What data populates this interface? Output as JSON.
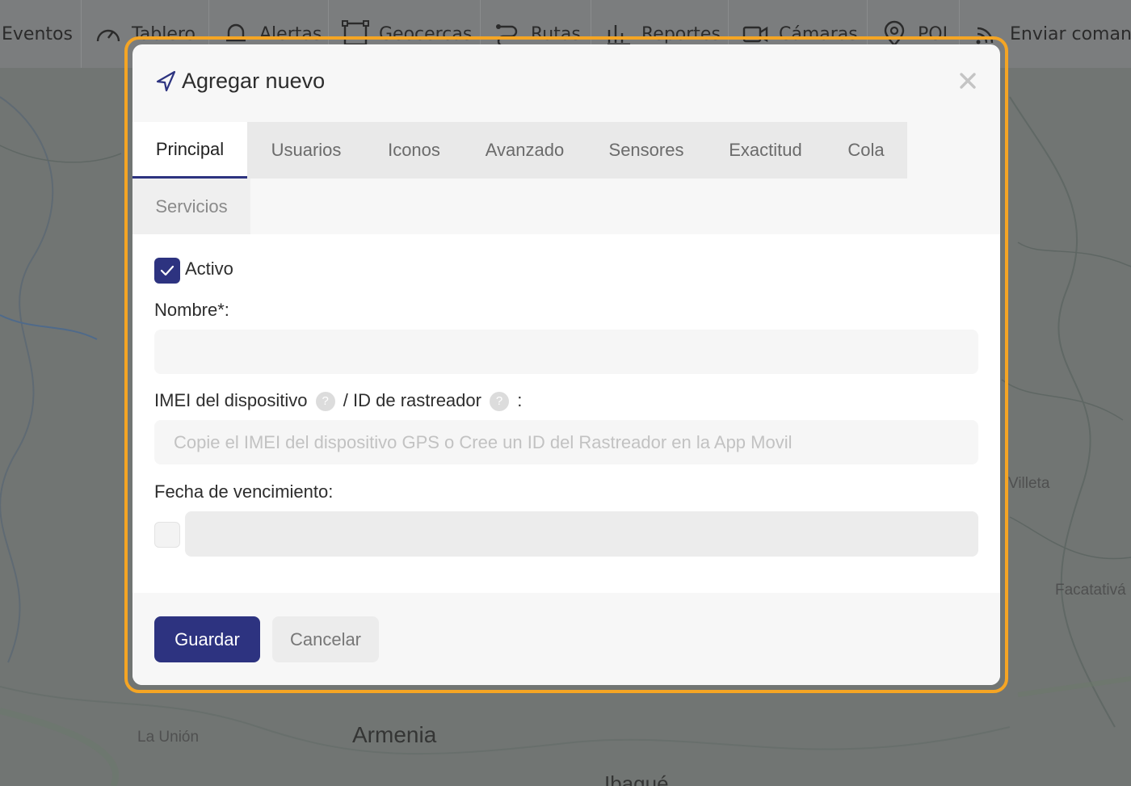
{
  "nav": {
    "items": [
      {
        "label": "Eventos",
        "icon": "none"
      },
      {
        "label": "Tablero",
        "icon": "gauge-icon"
      },
      {
        "label": "Alertas",
        "icon": "bell-icon"
      },
      {
        "label": "Geocercas",
        "icon": "polygon-icon"
      },
      {
        "label": "Rutas",
        "icon": "route-icon"
      },
      {
        "label": "Reportes",
        "icon": "chart-icon"
      },
      {
        "label": "Cámaras",
        "icon": "camera-icon"
      },
      {
        "label": "POI",
        "icon": "pin-icon"
      },
      {
        "label": "Enviar comando",
        "icon": "signal-icon"
      }
    ]
  },
  "map": {
    "labels": {
      "villeta": "Villeta",
      "facatativa": "Facatativá",
      "la_union": "La Unión",
      "armenia": "Armenia",
      "ibague": "Ibagué"
    }
  },
  "modal": {
    "title": "Agregar nuevo",
    "title_icon": "navigation-arrow-icon",
    "close_icon": "close-icon",
    "highlight_color": "#f5a524",
    "accent_color": "#2d3380",
    "tabs": [
      {
        "label": "Principal",
        "active": true
      },
      {
        "label": "Usuarios",
        "active": false
      },
      {
        "label": "Iconos",
        "active": false
      },
      {
        "label": "Avanzado",
        "active": false
      },
      {
        "label": "Sensores",
        "active": false
      },
      {
        "label": "Exactitud",
        "active": false
      },
      {
        "label": "Cola",
        "active": false
      },
      {
        "label": "Servicios",
        "active": false
      }
    ],
    "form": {
      "active_checkbox": {
        "label": "Activo",
        "checked": true
      },
      "name": {
        "label": "Nombre*:",
        "value": "",
        "placeholder": ""
      },
      "imei": {
        "label_part1": "IMEI del dispositivo",
        "label_part2": "/ ID de rastreador",
        "label_part3": ":",
        "help_glyph": "?",
        "value": "",
        "placeholder": "Copie el IMEI del dispositivo GPS o Cree un ID del Rastreador en la App Movil"
      },
      "expiration": {
        "label": "Fecha de vencimiento:",
        "enabled": false,
        "value": ""
      }
    },
    "buttons": {
      "save": "Guardar",
      "cancel": "Cancelar"
    }
  }
}
